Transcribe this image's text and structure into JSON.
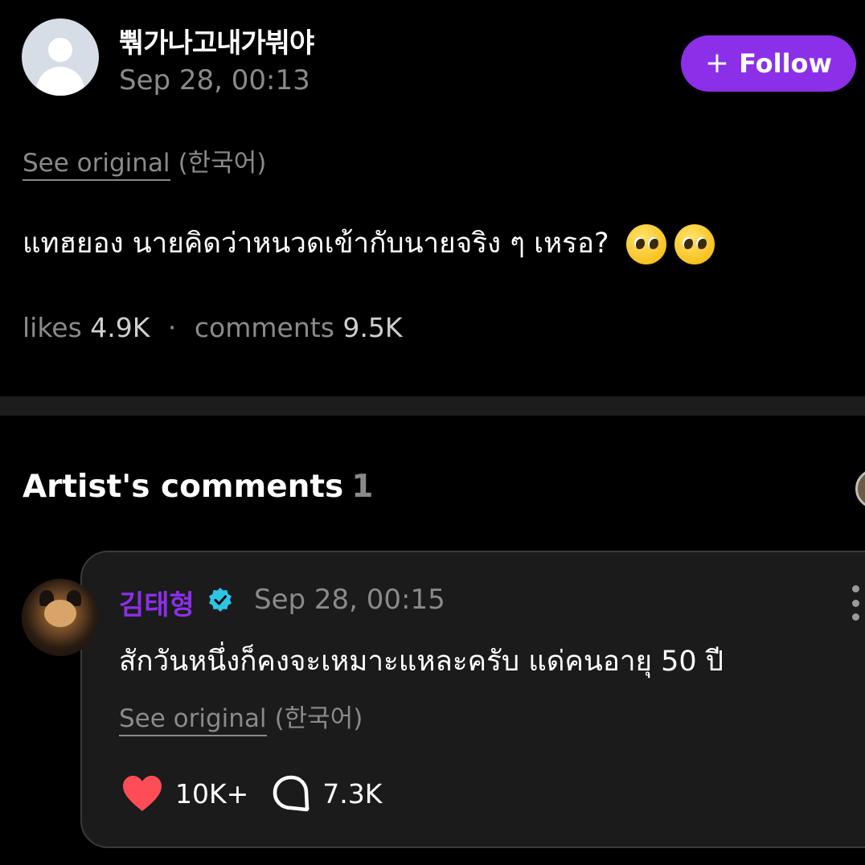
{
  "post": {
    "username": "뿪가나고내가붜야",
    "timestamp": "Sep 28, 00:13",
    "follow_label": "Follow",
    "see_original": "See original",
    "language": "(한국어)",
    "text": "แทฮยอง นายคิดว่าหนวดเข้ากับนายจริง ๆ เหรอ?",
    "emoji_name": "pleading-face",
    "likes_label": "likes",
    "likes_count": "4.9K",
    "separator": "·",
    "comments_label": "comments",
    "comments_count": "9.5K"
  },
  "artist_comments": {
    "title": "Artist's comments",
    "count": "1",
    "items": [
      {
        "author": "김태형",
        "verified": true,
        "timestamp": "Sep 28, 00:15",
        "text": "สักวันหนึ่งก็คงจะเหมาะแหละครับ แด่คนอายุ 50 ปี",
        "see_original": "See original",
        "language": "(한국어)",
        "likes": "10K+",
        "replies": "7.3K"
      }
    ]
  },
  "colors": {
    "accent": "#8c2fe8",
    "background": "#000000",
    "muted_text": "#8a8a8a",
    "heart": "#ff4d57",
    "verified": "#2ec4e6"
  }
}
